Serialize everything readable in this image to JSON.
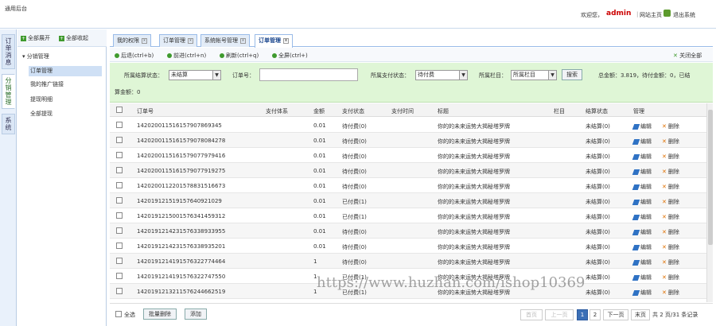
{
  "header": {
    "app_title": "通用后台",
    "welcome": "欢迎您，",
    "user": "admin",
    "home": "网站主页",
    "separator": "|",
    "exit": "退出系统"
  },
  "vtabs": [
    "订单消息",
    "分销管理",
    "系统"
  ],
  "left": {
    "expand_all": "全部展开",
    "collapse_all": "全部收起",
    "root": "分销管理",
    "items": [
      "订单管理",
      "我的推广链接",
      "提现明细",
      "全部提现"
    ]
  },
  "tabs": [
    "我的权限",
    "订单管理",
    "系统帐号管理",
    "订单管理"
  ],
  "toolbar": {
    "back": "后退(ctrl+b)",
    "forward": "前进(ctrl+n)",
    "refresh": "刷新(ctrl+q)",
    "fullscreen": "全屏(ctrl+)",
    "close_all": "关闭全部"
  },
  "filter": {
    "settle_label": "所属结算状态：",
    "settle_value": "未结算",
    "order_label": "订单号：",
    "pay_label": "所属支付状态：",
    "pay_value": "待付费",
    "column_label": "所属栏目：",
    "column_value": "所属栏目",
    "search": "搜索",
    "total": "总金额：3.819，待付金额：0，已结",
    "total2": "算金额：0"
  },
  "grid": {
    "headers": [
      "订单号",
      "支付体系",
      "金额",
      "支付状态",
      "支付时间",
      "标题",
      "栏目",
      "结算状态",
      "管理"
    ],
    "rows": [
      [
        "142020011516157907869345",
        "0.01",
        "待付费(0)",
        "你的的未来运势大揭秘塔罗牌",
        "未结算(0)"
      ],
      [
        "142020011516157907808427​8",
        "0.01",
        "待付费(0)",
        "你的的未来运势大揭秘塔罗牌",
        "未结算(0)"
      ],
      [
        "142020011516157907797941​6",
        "0.01",
        "待付费(0)",
        "你的的未来运势大揭秘塔罗牌",
        "未结算(0)"
      ],
      [
        "142020011516157907791927​5",
        "0.01",
        "待付费(0)",
        "你的的未来运势大揭秘塔罗牌",
        "未结算(0)"
      ],
      [
        "142020011220157883151667​3",
        "0.01",
        "待付费(0)",
        "你的的未来运势大揭秘塔罗牌",
        "未结算(0)"
      ],
      [
        "142019121519157640921029",
        "0.01",
        "已付费(1)",
        "你的的未来运势大揭秘塔罗牌",
        "未结算(0)"
      ],
      [
        "142019121500157634145931​2",
        "0.01",
        "已付费(1)",
        "你的的未来运势大揭秘塔罗牌",
        "未结算(0)"
      ],
      [
        "142019121423157633893395​5",
        "0.01",
        "待付费(0)",
        "你的的未来运势大揭秘塔罗牌",
        "未结算(0)"
      ],
      [
        "142019121423157633893520​1",
        "0.01",
        "待付费(0)",
        "你的的未来运势大揭秘塔罗牌",
        "未结算(0)"
      ],
      [
        "142019121419157632277446​4",
        "1",
        "待付费(0)",
        "你的的未来运势大揭秘塔罗牌",
        "未结算(0)"
      ],
      [
        "142019121419157632274755​0",
        "1",
        "已付费(1)",
        "你的的未来运势大揭秘塔罗牌",
        "未结算(0)"
      ],
      [
        "142019121321157624466251​9",
        "1",
        "已付费(1)",
        "你的的未来运势大揭秘塔罗牌",
        "未结算(0)"
      ]
    ],
    "edit": "编辑",
    "delete": "删除"
  },
  "footer": {
    "select_all": "全选",
    "batch_delete": "批量删除",
    "add": "添加",
    "first": "首页",
    "prev": "上一页",
    "p1": "1",
    "p2": "2",
    "next": "下一页",
    "last": "末页",
    "info": "共 2 页/31 条记录"
  },
  "watermark": "https://www.huzhan.com/ishop10369",
  "colors": {
    "accent": "#3f9a2e",
    "filter_bg": "#dff6d6",
    "user": "#cc0000",
    "page_current": "#3b6fb6"
  }
}
